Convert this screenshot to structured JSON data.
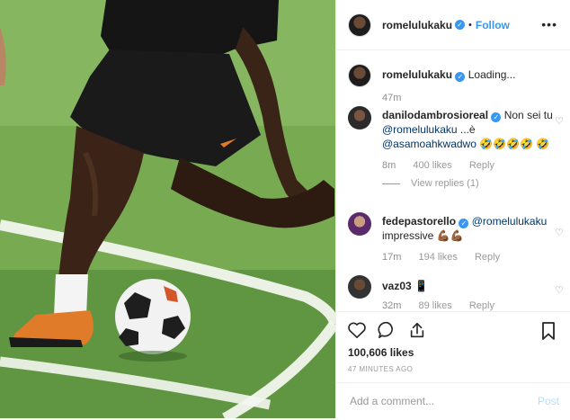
{
  "post": {
    "username": "romelulukaku",
    "follow_label": "Follow",
    "more_label": "•••",
    "likes": "100,606 likes",
    "time_ago": "47 MINUTES AGO",
    "add_comment_placeholder": "Add a comment...",
    "post_label": "Post"
  },
  "caption": {
    "username": "romelulukaku",
    "text": "Loading...",
    "time": "47m"
  },
  "comments": [
    {
      "username": "danilodambrosioreal",
      "mention_1": "@romelulukaku",
      "text_1": "Non sei tu",
      "text_2": "...è",
      "mention_2": "@asamoahkwadwo",
      "emoji": "🤣🤣🤣🤣 🤣",
      "time": "8m",
      "likes": "400 likes",
      "reply_label": "Reply",
      "view_replies": "View replies (1)"
    },
    {
      "username": "fedepastorello",
      "mention_1": "@romelulukaku",
      "text_1": "impressive 💪🏾💪🏾",
      "time": "17m",
      "likes": "194 likes",
      "reply_label": "Reply"
    },
    {
      "username": "vaz03",
      "text_1": "📱",
      "time": "32m",
      "likes": "89 likes",
      "reply_label": "Reply"
    }
  ],
  "icons": {
    "like": "heart-icon",
    "comment": "comment-icon",
    "share": "share-icon",
    "save": "bookmark-icon",
    "verified": "verified-badge-icon"
  },
  "colors": {
    "link_blue": "#3897f0",
    "mention_blue": "#003569",
    "grass_green": "#6ea046"
  }
}
